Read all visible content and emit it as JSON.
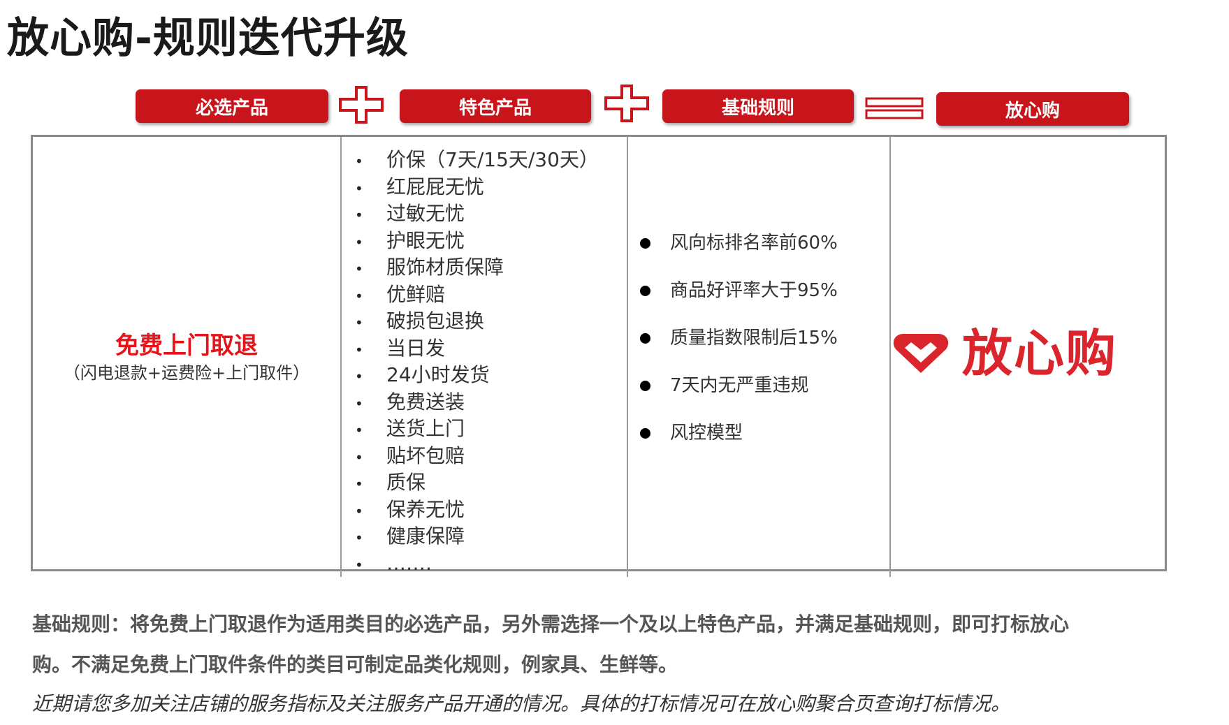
{
  "title": "放心购-规则迭代升级",
  "formula": {
    "box1": "必选产品",
    "box2": "特色产品",
    "box3": "基础规则",
    "box4": "放心购"
  },
  "required_product": {
    "main": "免费上门取退",
    "sub": "（闪电退款+运费险+上门取件）"
  },
  "feature_products": [
    "价保（7天/15天/30天）",
    "红屁屁无忧",
    "过敏无忧",
    "护眼无忧",
    "服饰材质保障",
    "优鲜赔",
    "破损包退换",
    "当日发",
    "24小时发货",
    "免费送装",
    "送货上门",
    "贴坏包赔",
    "质保",
    "保养无忧",
    "健康保障",
    "……."
  ],
  "base_rules": [
    "风向标排名率前60%",
    "商品好评率大于95%",
    "质量指数限制后15%",
    "7天内无严重违规",
    "风控模型"
  ],
  "logo": {
    "text": "放心购",
    "icon": "heart-logo-icon",
    "color": "#d9252b"
  },
  "footer": {
    "line1": "基础规则：将免费上门取退作为适用类目的必选产品，另外需选择一个及以上特色产品，并满足基础规则，即可打标放心",
    "line2": "购。不满足免费上门取件条件的类目可制定品类化规则，例家具、生鲜等。",
    "line3": "近期请您多加关注店铺的服务指标及关注服务产品开通的情况。具体的打标情况可在放心购聚合页查询打标情况。"
  },
  "colors": {
    "accent": "#c8151b",
    "highlight": "#e8131a"
  }
}
